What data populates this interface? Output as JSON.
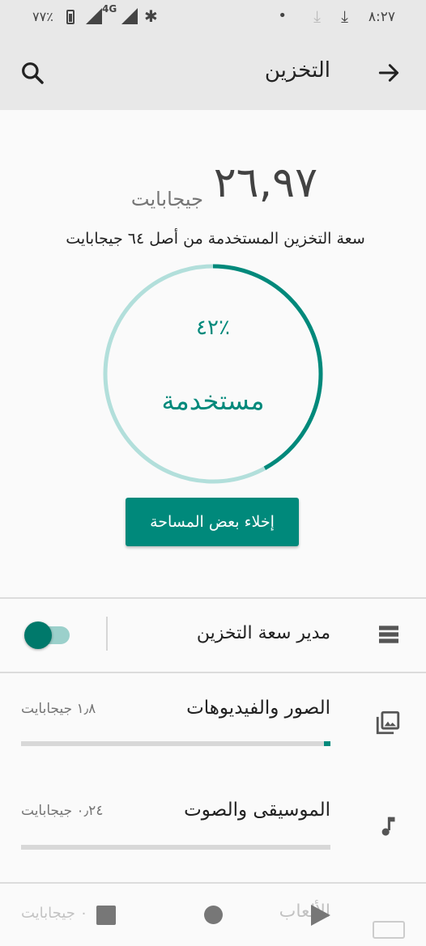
{
  "status_bar": {
    "time": "٨:٢٧",
    "battery": "٧٧٪",
    "network": "4G"
  },
  "app_bar": {
    "title": "التخزين"
  },
  "summary": {
    "used_value": "٢٦,٩٧",
    "used_unit": "جيجابايت",
    "caption": "سعة التخزين المستخدمة من أصل ٦٤ جيجابايت",
    "percent_label": "٤٢٪",
    "used_word": "مستخدمة",
    "used_fraction": 0.42,
    "free_button": "إخلاء بعض المساحة"
  },
  "storage_manager": {
    "label": "مدير سعة التخزين",
    "enabled": true
  },
  "categories": [
    {
      "label": "الصور والفيديوهات",
      "size": "١٫٨ جيجابايت",
      "fraction": 0.02,
      "icon": "photo-library-icon"
    },
    {
      "label": "الموسيقى والصوت",
      "size": "٠٫٢٤ جيجابايت",
      "fraction": 0.0,
      "icon": "music-note-icon"
    },
    {
      "label": "الألعاب",
      "size": "٠ جيجابايت",
      "icon": "gamepad-icon"
    }
  ],
  "colors": {
    "accent": "#00897b",
    "ring_track": "#b2dfdb",
    "app_bar": "#e8e8e8"
  }
}
